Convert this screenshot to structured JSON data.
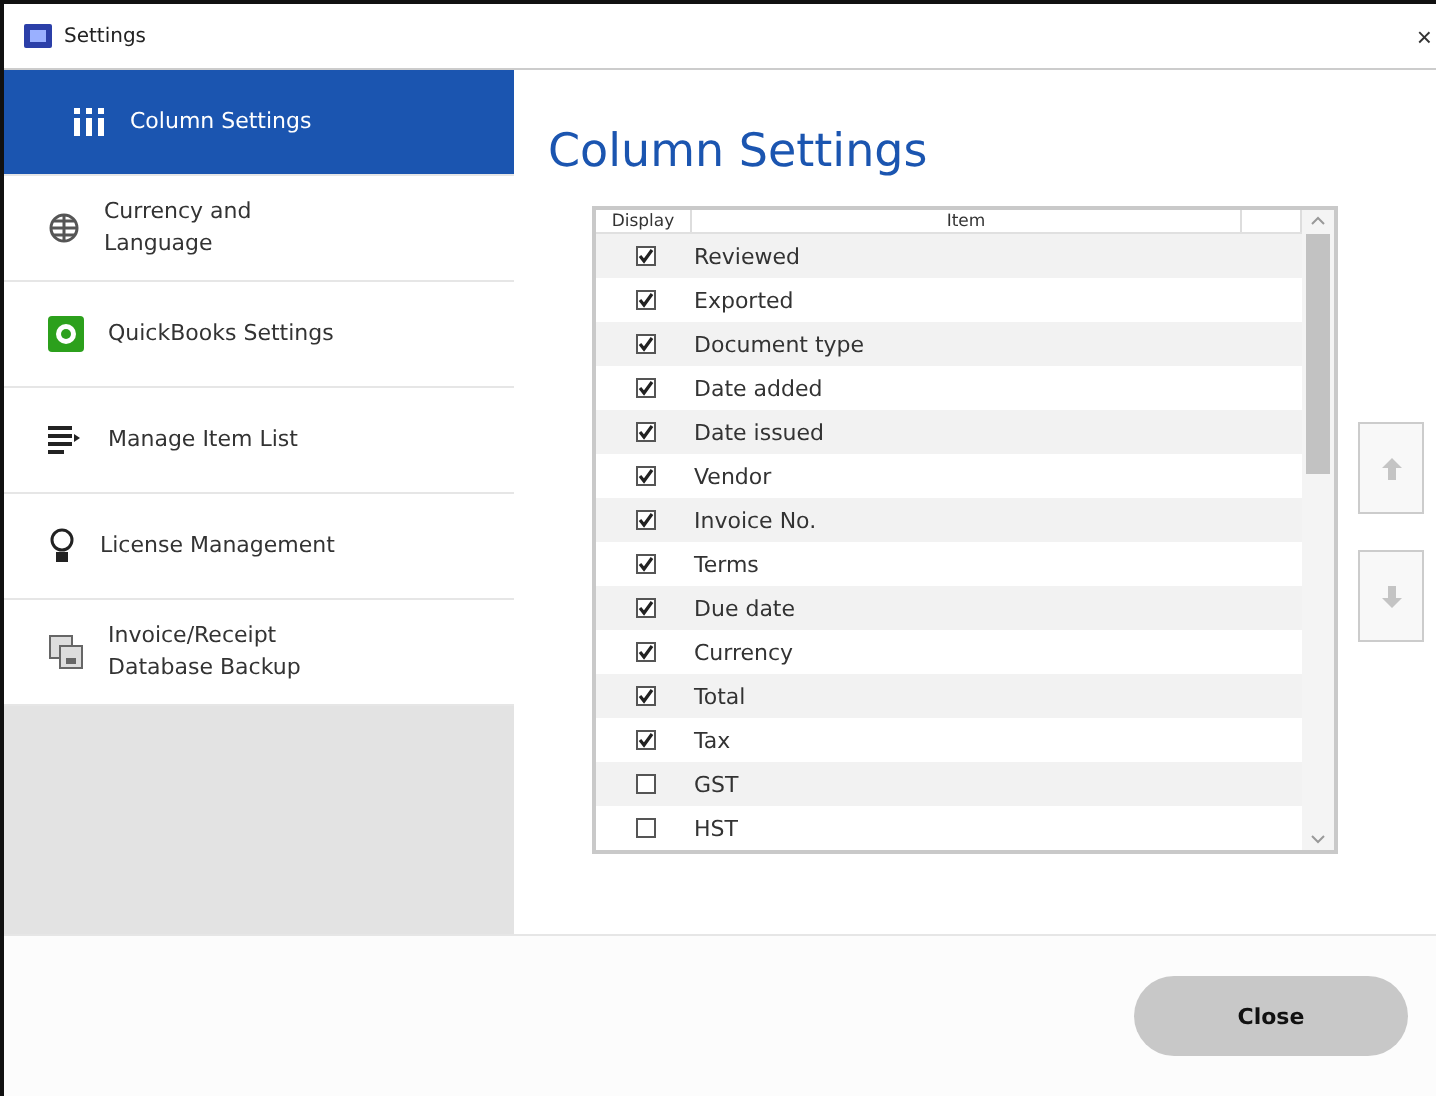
{
  "window": {
    "title": "Settings",
    "close": "×"
  },
  "sidebar": {
    "items": [
      {
        "label": "Column Settings",
        "kind": "columns",
        "selected": true
      },
      {
        "label": "Currency and Language",
        "kind": "globe",
        "selected": false
      },
      {
        "label": "QuickBooks Settings",
        "kind": "quickbooks",
        "selected": false
      },
      {
        "label": "Manage Item List",
        "kind": "list",
        "selected": false
      },
      {
        "label": "License Management",
        "kind": "bulb",
        "selected": false
      },
      {
        "label": "Invoice/Receipt Database Backup",
        "kind": "backup",
        "selected": false
      }
    ]
  },
  "heading": "Column Settings",
  "table": {
    "columns": [
      "Display",
      "Item"
    ],
    "rows": [
      {
        "item": "Reviewed",
        "checked": true
      },
      {
        "item": "Exported",
        "checked": true
      },
      {
        "item": "Document type",
        "checked": true
      },
      {
        "item": "Date added",
        "checked": true
      },
      {
        "item": "Date issued",
        "checked": true
      },
      {
        "item": "Vendor",
        "checked": true
      },
      {
        "item": "Invoice No.",
        "checked": true
      },
      {
        "item": "Terms",
        "checked": true
      },
      {
        "item": "Due date",
        "checked": true
      },
      {
        "item": "Currency",
        "checked": true
      },
      {
        "item": "Total",
        "checked": true
      },
      {
        "item": "Tax",
        "checked": true
      },
      {
        "item": "GST",
        "checked": false
      },
      {
        "item": "HST",
        "checked": false
      }
    ]
  },
  "footer": {
    "button": "Close"
  }
}
